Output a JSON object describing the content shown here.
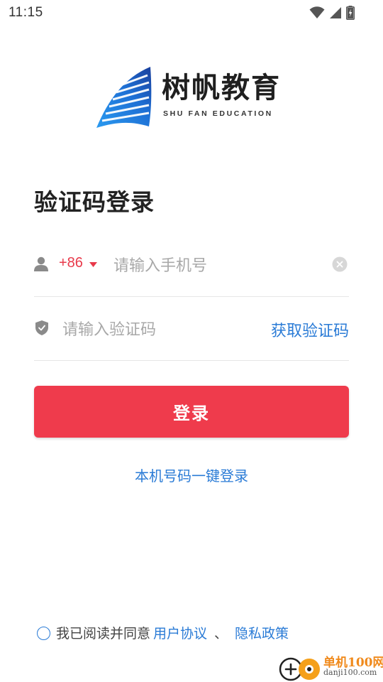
{
  "status_bar": {
    "time": "11:15",
    "icons": [
      "wifi-icon",
      "signal-icon",
      "battery-charging-icon"
    ]
  },
  "logo": {
    "title": "树帆教育",
    "subtitle": "SHU FAN EDUCATION",
    "brand_color": "#1e7fe0"
  },
  "page_title": "验证码登录",
  "phone": {
    "icon": "user-icon",
    "country_code": "+86",
    "placeholder": "请输入手机号",
    "value": "",
    "clear_icon": "clear-icon"
  },
  "code": {
    "icon": "shield-icon",
    "placeholder": "请输入验证码",
    "value": "",
    "get_code_label": "获取验证码"
  },
  "login_button": {
    "label": "登录",
    "color": "#ef3b4c"
  },
  "one_click_login": "本机号码一键登录",
  "agreement": {
    "text": "我已阅读并同意",
    "user_agreement": "用户协议",
    "separator": "、",
    "privacy_policy": "隐私政策",
    "accent": "#2a7bd6"
  },
  "watermark": {
    "title": "单机100网",
    "url": "danji100.com"
  }
}
